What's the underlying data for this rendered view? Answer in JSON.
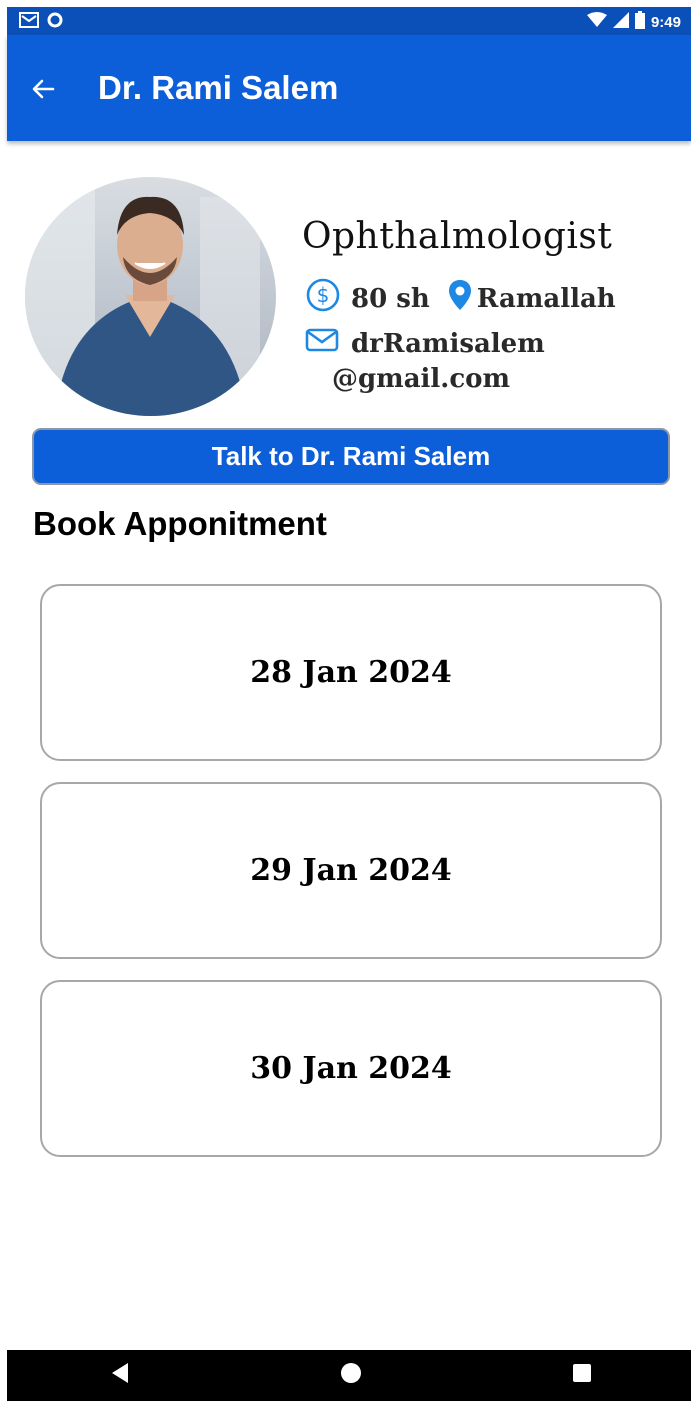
{
  "status_bar": {
    "time": "9:49",
    "left_icons": [
      "gmail-icon",
      "circle-notification-icon"
    ],
    "right_icons": [
      "wifi-icon",
      "signal-icon",
      "battery-icon"
    ]
  },
  "app_bar": {
    "title": "Dr. Rami Salem",
    "back_icon": "arrow-left-icon",
    "background": "#0d5fd9"
  },
  "doctor": {
    "specialty": "Ophthalmologist",
    "price": "80 sh",
    "price_icon": "dollar-circle-icon",
    "location": "Ramallah",
    "location_icon": "location-pin-icon",
    "email_line1": "drRamisalem",
    "email_line2": "@gmail.com",
    "email_icon": "mail-icon"
  },
  "talk_button": {
    "label": "Talk to Dr. Rami Salem"
  },
  "booking": {
    "title": "Book Apponitment",
    "dates": [
      "28 Jan 2024",
      "29 Jan 2024",
      "30 Jan 2024"
    ]
  },
  "nav_bar": {
    "buttons": [
      "back-triangle-icon",
      "home-circle-icon",
      "recents-square-icon"
    ]
  },
  "colors": {
    "primary": "#0d5fd9",
    "status_bar": "#0b4fb8",
    "icon_accent": "#1e88e5"
  }
}
